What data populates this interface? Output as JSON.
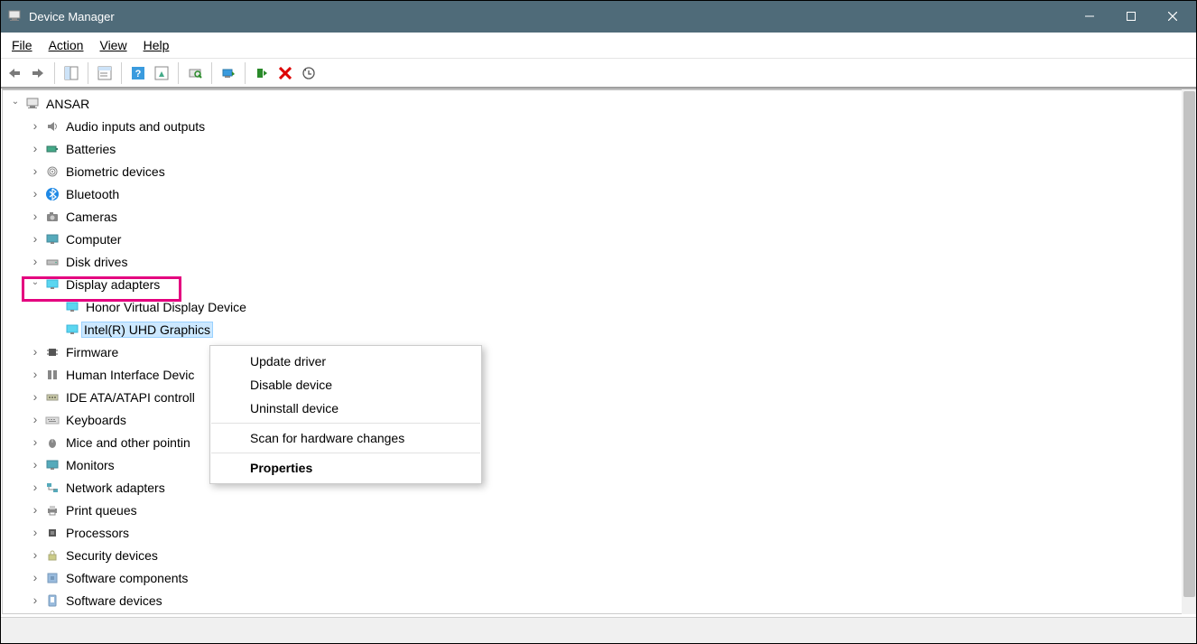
{
  "window": {
    "title": "Device Manager"
  },
  "menu": {
    "file": "File",
    "action": "Action",
    "view": "View",
    "help": "Help"
  },
  "tree": {
    "root": "ANSAR",
    "categories": [
      {
        "id": "audio",
        "label": "Audio inputs and outputs"
      },
      {
        "id": "batteries",
        "label": "Batteries"
      },
      {
        "id": "biometric",
        "label": "Biometric devices"
      },
      {
        "id": "bluetooth",
        "label": "Bluetooth"
      },
      {
        "id": "cameras",
        "label": "Cameras"
      },
      {
        "id": "computer",
        "label": "Computer"
      },
      {
        "id": "disk",
        "label": "Disk drives"
      },
      {
        "id": "display",
        "label": "Display adapters",
        "expanded": true,
        "children": [
          {
            "id": "honor-virtual",
            "label": "Honor Virtual Display Device"
          },
          {
            "id": "intel-uhd",
            "label": "Intel(R) UHD Graphics",
            "selected": true
          }
        ]
      },
      {
        "id": "firmware",
        "label": "Firmware"
      },
      {
        "id": "hid",
        "label": "Human Interface Devic"
      },
      {
        "id": "ide",
        "label": "IDE ATA/ATAPI controll"
      },
      {
        "id": "keyboards",
        "label": "Keyboards"
      },
      {
        "id": "mice",
        "label": "Mice and other pointin"
      },
      {
        "id": "monitors",
        "label": "Monitors"
      },
      {
        "id": "network",
        "label": "Network adapters"
      },
      {
        "id": "print",
        "label": "Print queues"
      },
      {
        "id": "processors",
        "label": "Processors"
      },
      {
        "id": "security",
        "label": "Security devices"
      },
      {
        "id": "swcomp",
        "label": "Software components"
      },
      {
        "id": "swdev",
        "label": "Software devices"
      }
    ]
  },
  "context_menu": {
    "update": "Update driver",
    "disable": "Disable device",
    "uninstall": "Uninstall device",
    "scan": "Scan for hardware changes",
    "properties": "Properties"
  }
}
